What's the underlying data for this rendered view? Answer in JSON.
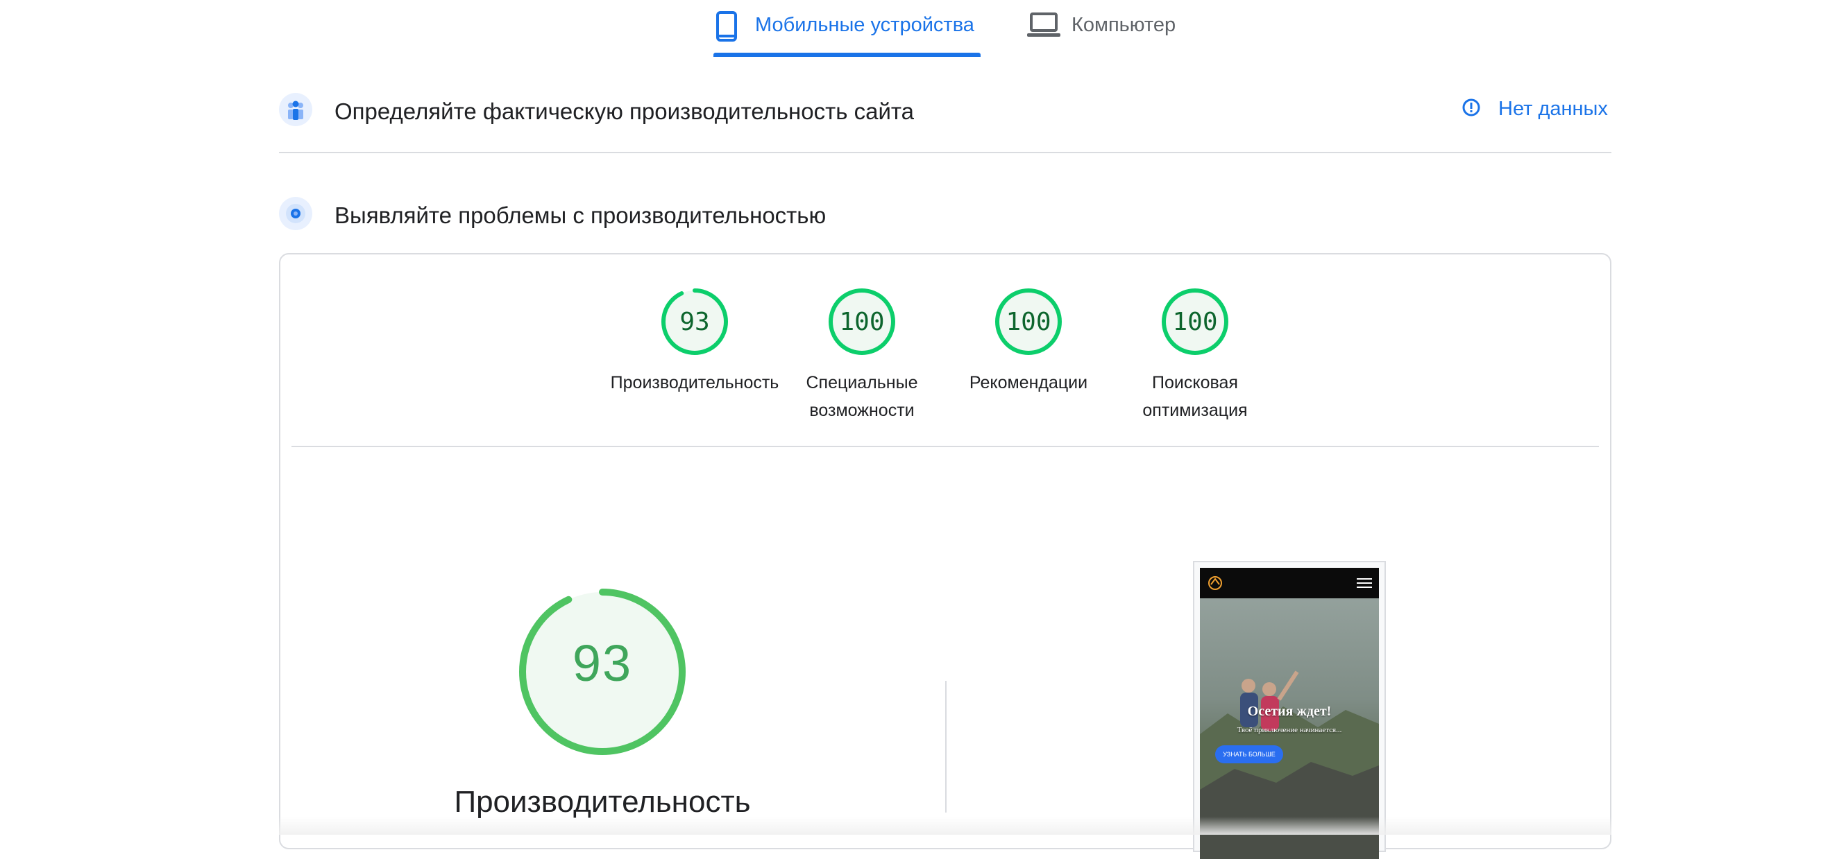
{
  "tabs": [
    {
      "label": "Мобильные устройства",
      "active": true,
      "icon": "smartphone-icon"
    },
    {
      "label": "Компьютер",
      "active": false,
      "icon": "laptop-icon"
    }
  ],
  "field_data": {
    "title": "Определяйте фактическую производительность сайта",
    "status_label": "Нет данных",
    "icon": "users-icon",
    "status_icon": "info-icon"
  },
  "lab_data": {
    "title": "Выявляйте проблемы с производительностью",
    "icon": "target-icon"
  },
  "scores": [
    {
      "value": 93,
      "label_lines": [
        "Производительность"
      ]
    },
    {
      "value": 100,
      "label_lines": [
        "Специальные",
        "возможности"
      ]
    },
    {
      "value": 100,
      "label_lines": [
        "Рекомендации"
      ]
    },
    {
      "value": 100,
      "label_lines": [
        "Поисковая",
        "оптимизация"
      ]
    }
  ],
  "main_score": {
    "value": 93,
    "label": "Производительность"
  },
  "screenshot_preview": {
    "hero_title": "Осетия ждет!",
    "hero_subtitle": "Твоё приключение начинается...",
    "cta_label": "УЗНАТЬ БОЛЬШЕ"
  },
  "colors": {
    "accent": "#1a73e8",
    "score_pass": "#0cce6b",
    "score_text": "#0d652d",
    "divider": "#dadce0"
  }
}
